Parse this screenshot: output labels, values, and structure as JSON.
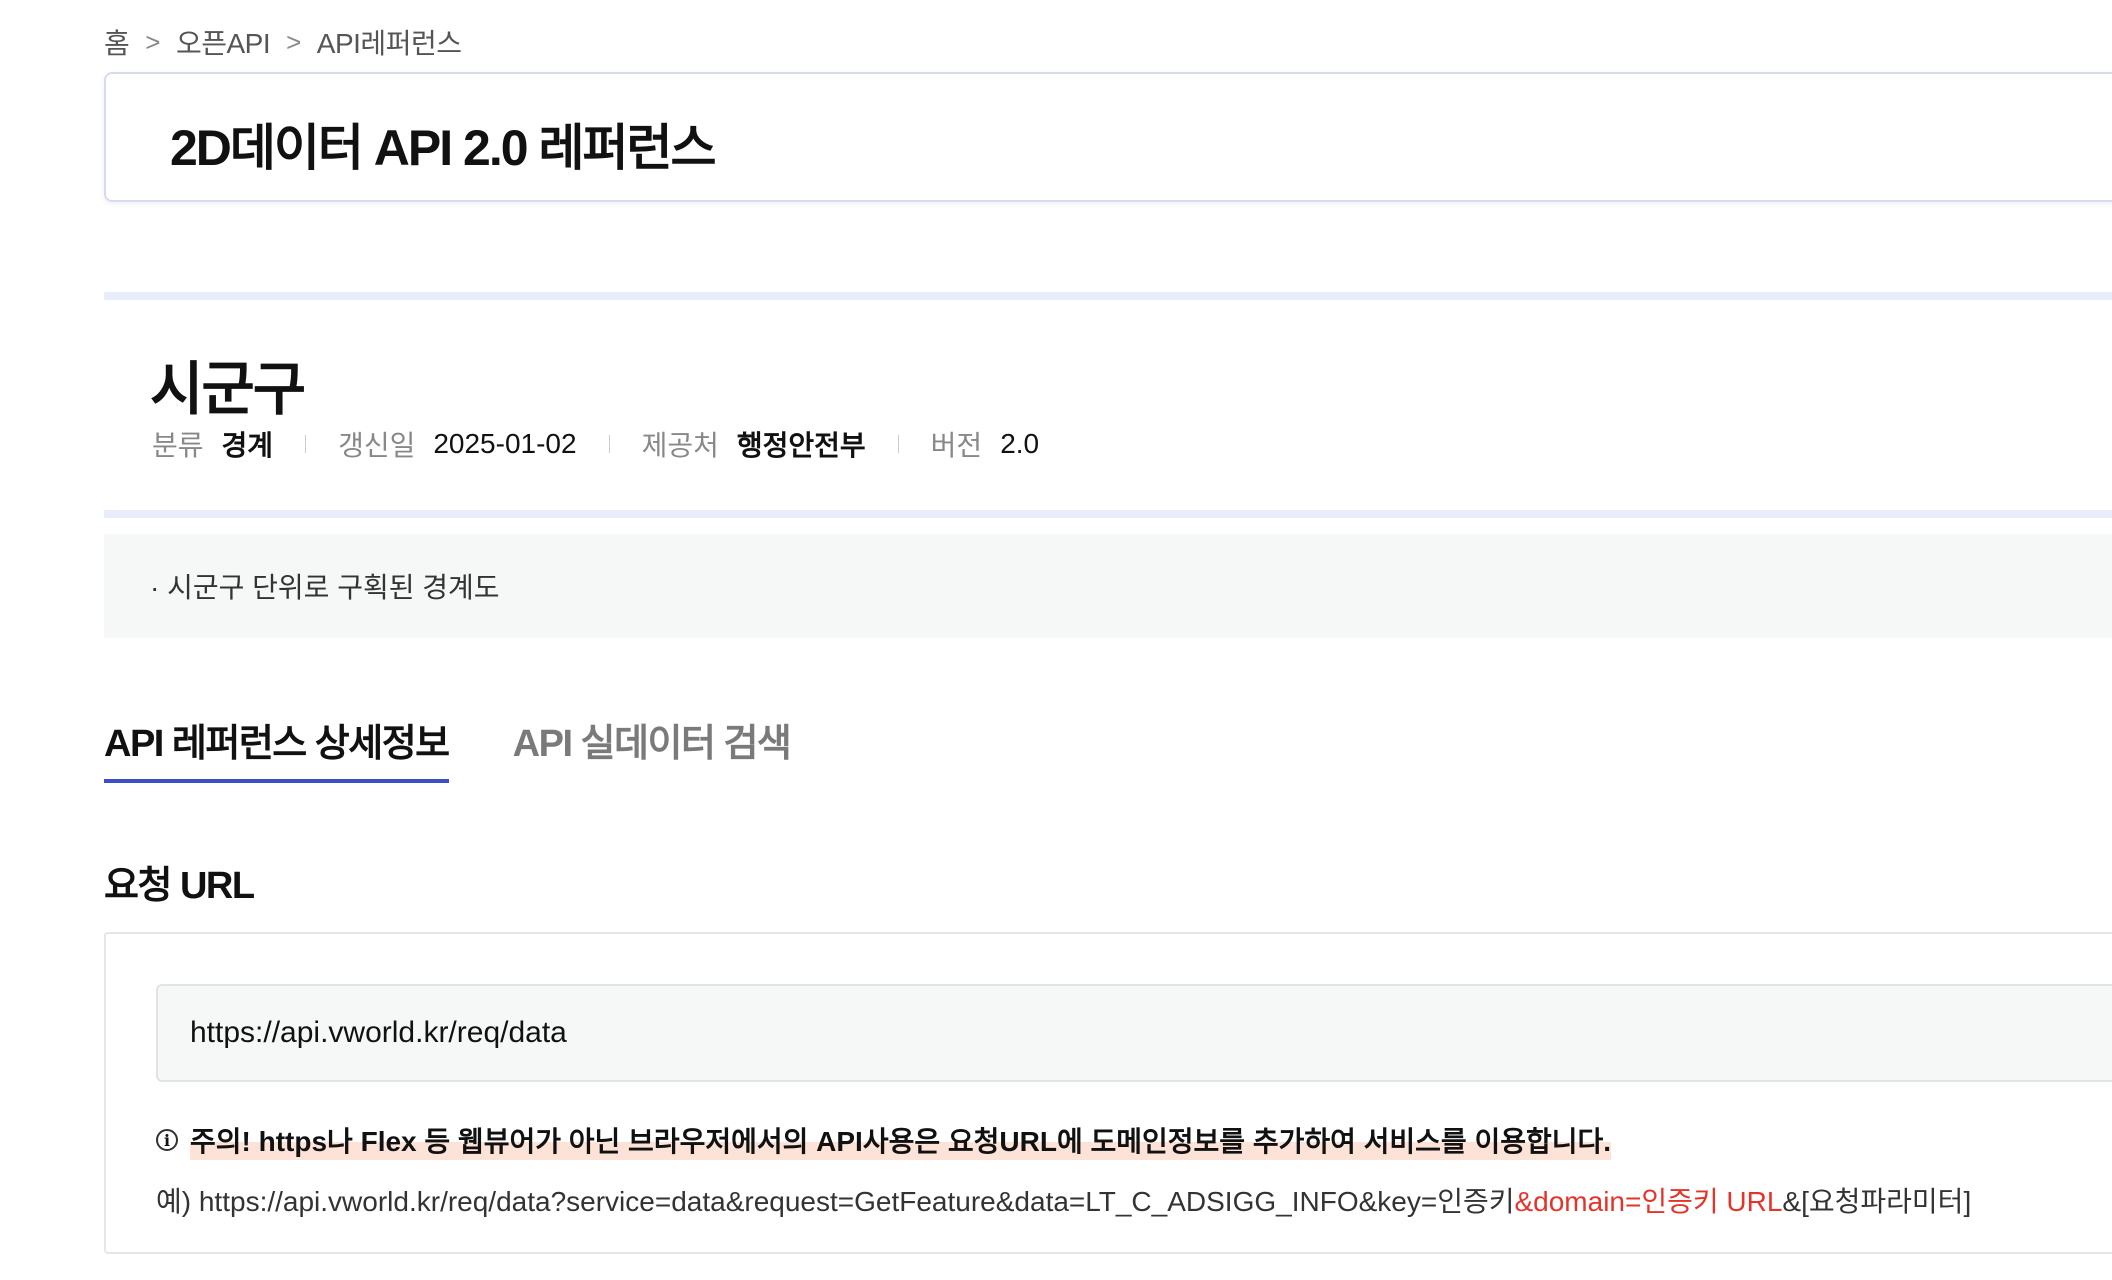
{
  "breadcrumb": {
    "items": [
      "홈",
      "오픈API",
      "API레퍼런스"
    ],
    "separator": ">"
  },
  "page_title": "2D데이터 API 2.0 레퍼런스",
  "section": {
    "title": "시군구",
    "meta": [
      {
        "label": "분류",
        "value": "경계"
      },
      {
        "label": "갱신일",
        "value": "2025-01-02"
      },
      {
        "label": "제공처",
        "value": "행정안전부"
      },
      {
        "label": "버전",
        "value": "2.0"
      }
    ],
    "description": "· 시군구 단위로 구획된 경계도"
  },
  "tabs": [
    {
      "label": "API 레퍼런스 상세정보",
      "active": true
    },
    {
      "label": "API 실데이터 검색",
      "active": false
    }
  ],
  "request": {
    "title": "요청 URL",
    "url": "https://api.vworld.kr/req/data",
    "notice_icon": "info-icon",
    "notice": "주의! https나 Flex 등 웹뷰어가 아닌 브라우저에서의 API사용은 요청URL에 도메인정보를 추가하여 서비스를 이용합니다.",
    "example_prefix": "예) https://api.vworld.kr/req/data?service=data&request=GetFeature&data=LT_C_ADSIGG_INFO&key=인증키",
    "example_highlight": "&domain=인증키 URL",
    "example_suffix": "&[요청파라미터]"
  },
  "colors": {
    "accent": "#3b4dc7",
    "highlight_text": "#e4342a",
    "notice_highlight": "#fde3d7",
    "divider": "#e9edfb"
  }
}
